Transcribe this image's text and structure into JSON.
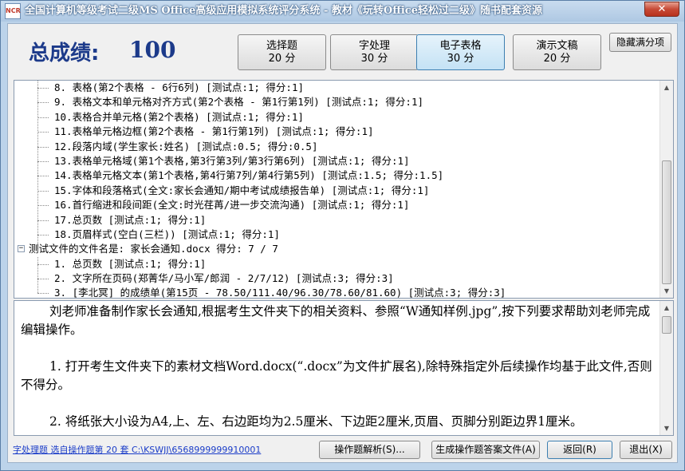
{
  "window": {
    "title": "全国计算机等级考试二级MS Office高级应用模拟系统评分系统 - 教材《玩转Office轻松过二级》随书配套资源",
    "icon_text": "NCR",
    "close_label": "✕"
  },
  "score": {
    "label": "总成绩:",
    "value": "100"
  },
  "categories": [
    {
      "name": "选择题",
      "score": "20 分"
    },
    {
      "name": "字处理",
      "score": "30 分"
    },
    {
      "name": "电子表格",
      "score": "30 分"
    },
    {
      "name": "演示文稿",
      "score": "20 分"
    }
  ],
  "hide_full_button": "隐藏满分项",
  "tree": {
    "rows": [
      {
        "kind": "child",
        "text": "8. 表格(第2个表格 - 6行6列) [测试点:1; 得分:1]"
      },
      {
        "kind": "child",
        "text": "9. 表格文本和单元格对齐方式(第2个表格 - 第1行第1列) [测试点:1; 得分:1]"
      },
      {
        "kind": "child",
        "text": "10.表格合并单元格(第2个表格) [测试点:1; 得分:1]"
      },
      {
        "kind": "child",
        "text": "11.表格单元格边框(第2个表格 - 第1行第1列) [测试点:1; 得分:1]"
      },
      {
        "kind": "child",
        "text": "12.段落内域(学生家长:姓名) [测试点:0.5; 得分:0.5]"
      },
      {
        "kind": "child",
        "text": "13.表格单元格域(第1个表格,第3行第3列/第3行第6列) [测试点:1; 得分:1]"
      },
      {
        "kind": "child",
        "text": "14.表格单元格文本(第1个表格,第4行第7列/第4行第5列) [测试点:1.5; 得分:1.5]"
      },
      {
        "kind": "child",
        "text": "15.字体和段落格式(全文:家长会通知/期中考试成绩报告单) [测试点:1; 得分:1]"
      },
      {
        "kind": "child",
        "text": "16.首行缩进和段间距(全文:时光荏苒/进一步交流沟通) [测试点:1; 得分:1]"
      },
      {
        "kind": "child",
        "text": "17.总页数 [测试点:1; 得分:1]"
      },
      {
        "kind": "child",
        "text": "18.页眉样式(空白(三栏)) [测试点:1; 得分:1]"
      },
      {
        "kind": "parent",
        "text": "测试文件的文件名是: 家长会通知.docx  得分: 7 / 7"
      },
      {
        "kind": "child",
        "text": "1. 总页数 [测试点:1; 得分:1]"
      },
      {
        "kind": "child",
        "text": "2. 文字所在页码(郑菁华/马小军/郎润 - 2/7/12) [测试点:3; 得分:3]"
      },
      {
        "kind": "child",
        "text": "3. [李北冥] 的成绩单(第15页 - 78.50/111.40/96.30/78.60/81.60) [测试点:3; 得分:3]"
      }
    ]
  },
  "description": {
    "paragraphs": [
      "刘老师准备制作家长会通知,根据考生文件夹下的相关资料、参照“W通知样例.jpg”,按下列要求帮助刘老师完成编辑操作。",
      "1. 打开考生文件夹下的素材文档Word.docx(“.docx”为文件扩展名),除特殊指定外后续操作均基于此文件,否则不得分。",
      "2. 将纸张大小设为A4,上、左、右边距均为2.5厘米、下边距2厘米,页眉、页脚分别距边界1厘米。"
    ]
  },
  "footer": {
    "status": "字处理题 选自操作题第 20 套  C:\\KSWJJ\\6568999999910001",
    "buttons": {
      "analysis": "操作题解析(S)...",
      "generate": "生成操作题答案文件(A)",
      "back": "返回(R)",
      "exit": "退出(X)"
    }
  }
}
